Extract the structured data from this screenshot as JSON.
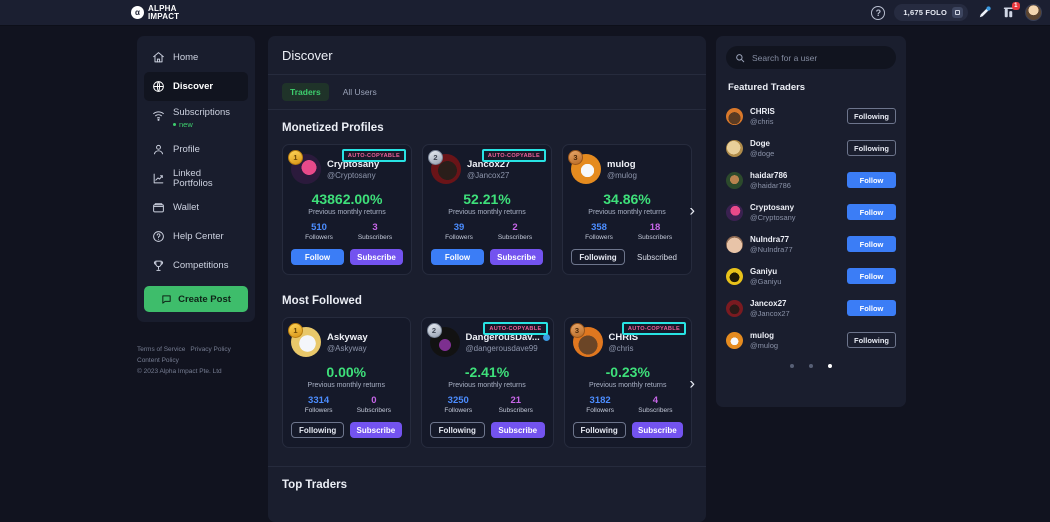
{
  "topbar": {
    "logo_line1": "ALPHA",
    "logo_line2": "IMPACT",
    "logo_mark": "alpha-logo-icon",
    "help_label": "?",
    "folo_label": "1,675 FOLO",
    "notification_count": "1"
  },
  "sidebar": {
    "items": [
      {
        "label": "Home",
        "icon": "home-icon",
        "active": false
      },
      {
        "label": "Discover",
        "icon": "globe-icon",
        "active": true
      },
      {
        "label": "Subscriptions",
        "icon": "wifi-icon",
        "active": false,
        "badge": "new"
      },
      {
        "label": "Profile",
        "icon": "user-icon",
        "active": false
      },
      {
        "label": "Linked Portfolios",
        "icon": "chart-icon",
        "active": false
      },
      {
        "label": "Wallet",
        "icon": "wallet-icon",
        "active": false
      },
      {
        "label": "Help Center",
        "icon": "help-circle-icon",
        "active": false
      },
      {
        "label": "Competitions",
        "icon": "trophy-icon",
        "active": false
      }
    ],
    "create_post": "Create Post"
  },
  "footer": {
    "terms": "Terms of Service",
    "privacy": "Privacy Policy",
    "content": "Content Policy",
    "copyright": "© 2023 Alpha Impact Pte. Ltd"
  },
  "main": {
    "title": "Discover",
    "tabs": [
      {
        "label": "Traders",
        "active": true
      },
      {
        "label": "All Users",
        "active": false
      }
    ],
    "sections": [
      {
        "title": "Monetized Profiles",
        "cards": [
          {
            "rank": "1",
            "name": "Cryptosany",
            "handle": "@Cryptosany",
            "verified": false,
            "auto_copyable": "AUTO-COPYABLE",
            "pct": "43862.00%",
            "pct_label": "Previous monthly returns",
            "followers": "510",
            "followers_label": "Followers",
            "subscribers": "3",
            "subscribers_label": "Subscribers",
            "btn1": "Follow",
            "btn1_style": "follow",
            "btn2": "Subscribe",
            "btn2_style": "subscribe",
            "avatar": "#2b1a3c"
          },
          {
            "rank": "2",
            "name": "Jancox27",
            "handle": "@Jancox27",
            "verified": false,
            "auto_copyable": "AUTO-COPYABLE",
            "pct": "52.21%",
            "pct_label": "Previous monthly returns",
            "followers": "39",
            "followers_label": "Followers",
            "subscribers": "2",
            "subscribers_label": "Subscribers",
            "btn1": "Follow",
            "btn1_style": "follow",
            "btn2": "Subscribe",
            "btn2_style": "subscribe",
            "avatar": "#6a1418"
          },
          {
            "rank": "3",
            "name": "mulog",
            "handle": "@mulog",
            "verified": false,
            "auto_copyable": "",
            "pct": "34.86%",
            "pct_label": "Previous monthly returns",
            "followers": "358",
            "followers_label": "Followers",
            "subscribers": "18",
            "subscribers_label": "Subscribers",
            "btn1": "Following",
            "btn1_style": "following",
            "btn2": "Subscribed",
            "btn2_style": "subscribed",
            "avatar": "#e58b1f"
          }
        ]
      },
      {
        "title": "Most Followed",
        "cards": [
          {
            "rank": "1",
            "name": "Askyway",
            "handle": "@Askyway",
            "verified": false,
            "auto_copyable": "",
            "pct": "0.00%",
            "pct_label": "Previous monthly returns",
            "followers": "3314",
            "followers_label": "Followers",
            "subscribers": "0",
            "subscribers_label": "Subscribers",
            "btn1": "Following",
            "btn1_style": "following",
            "btn2": "Subscribe",
            "btn2_style": "subscribe",
            "avatar": "#e9c86a"
          },
          {
            "rank": "2",
            "name": "DangerousDav...",
            "handle": "@dangerousdave99",
            "verified": true,
            "auto_copyable": "AUTO-COPYABLE",
            "pct": "-2.41%",
            "pct_label": "Previous monthly returns",
            "followers": "3250",
            "followers_label": "Followers",
            "subscribers": "21",
            "subscribers_label": "Subscribers",
            "btn1": "Following",
            "btn1_style": "following",
            "btn2": "Subscribe",
            "btn2_style": "subscribe",
            "avatar": "#121212"
          },
          {
            "rank": "3",
            "name": "CHRIS",
            "handle": "@chris",
            "verified": false,
            "auto_copyable": "AUTO-COPYABLE",
            "pct": "-0.23%",
            "pct_label": "Previous monthly returns",
            "followers": "3182",
            "followers_label": "Followers",
            "subscribers": "4",
            "subscribers_label": "Subscribers",
            "btn1": "Following",
            "btn1_style": "following",
            "btn2": "Subscribe",
            "btn2_style": "subscribe",
            "avatar": "#e0771f"
          }
        ]
      },
      {
        "title": "Top Traders",
        "cards": []
      }
    ]
  },
  "right": {
    "search_placeholder": "Search for a user",
    "search_value": "",
    "featured_title": "Featured Traders",
    "traders": [
      {
        "name": "CHRIS",
        "handle": "@chris",
        "action": "Following",
        "style": "following",
        "avatar": "#d9782a"
      },
      {
        "name": "Doge",
        "handle": "@doge",
        "action": "Following",
        "style": "following",
        "avatar": "#c9a35c"
      },
      {
        "name": "haidar786",
        "handle": "@haidar786",
        "action": "Follow",
        "style": "follow",
        "avatar": "#3a6b3a"
      },
      {
        "name": "Cryptosany",
        "handle": "@Cryptosany",
        "action": "Follow",
        "style": "follow",
        "avatar": "#4c2a6b"
      },
      {
        "name": "NuIndra77",
        "handle": "@NuIndra77",
        "action": "Follow",
        "style": "follow",
        "avatar": "#c4a28c"
      },
      {
        "name": "Ganiyu",
        "handle": "@Ganiyu",
        "action": "Follow",
        "style": "follow",
        "avatar": "#e8c21a"
      },
      {
        "name": "Jancox27",
        "handle": "@Jancox27",
        "action": "Follow",
        "style": "follow",
        "avatar": "#7a1a20"
      },
      {
        "name": "mulog",
        "handle": "@mulog",
        "action": "Following",
        "style": "following",
        "avatar": "#e58b1f"
      }
    ],
    "pager": {
      "count": 3,
      "active": 2
    }
  },
  "colors": {
    "accent_green": "#3ecf6e",
    "follow_blue": "#3b7df6",
    "subscribe_purple": "#7353ef",
    "followers_blue": "#4c8dff",
    "subscribers_pink": "#c766e8",
    "autocopy_border": "#28e3e3",
    "autocopy_text": "#f0609a",
    "bg": "#11131f",
    "panel": "#1a1e2e"
  }
}
